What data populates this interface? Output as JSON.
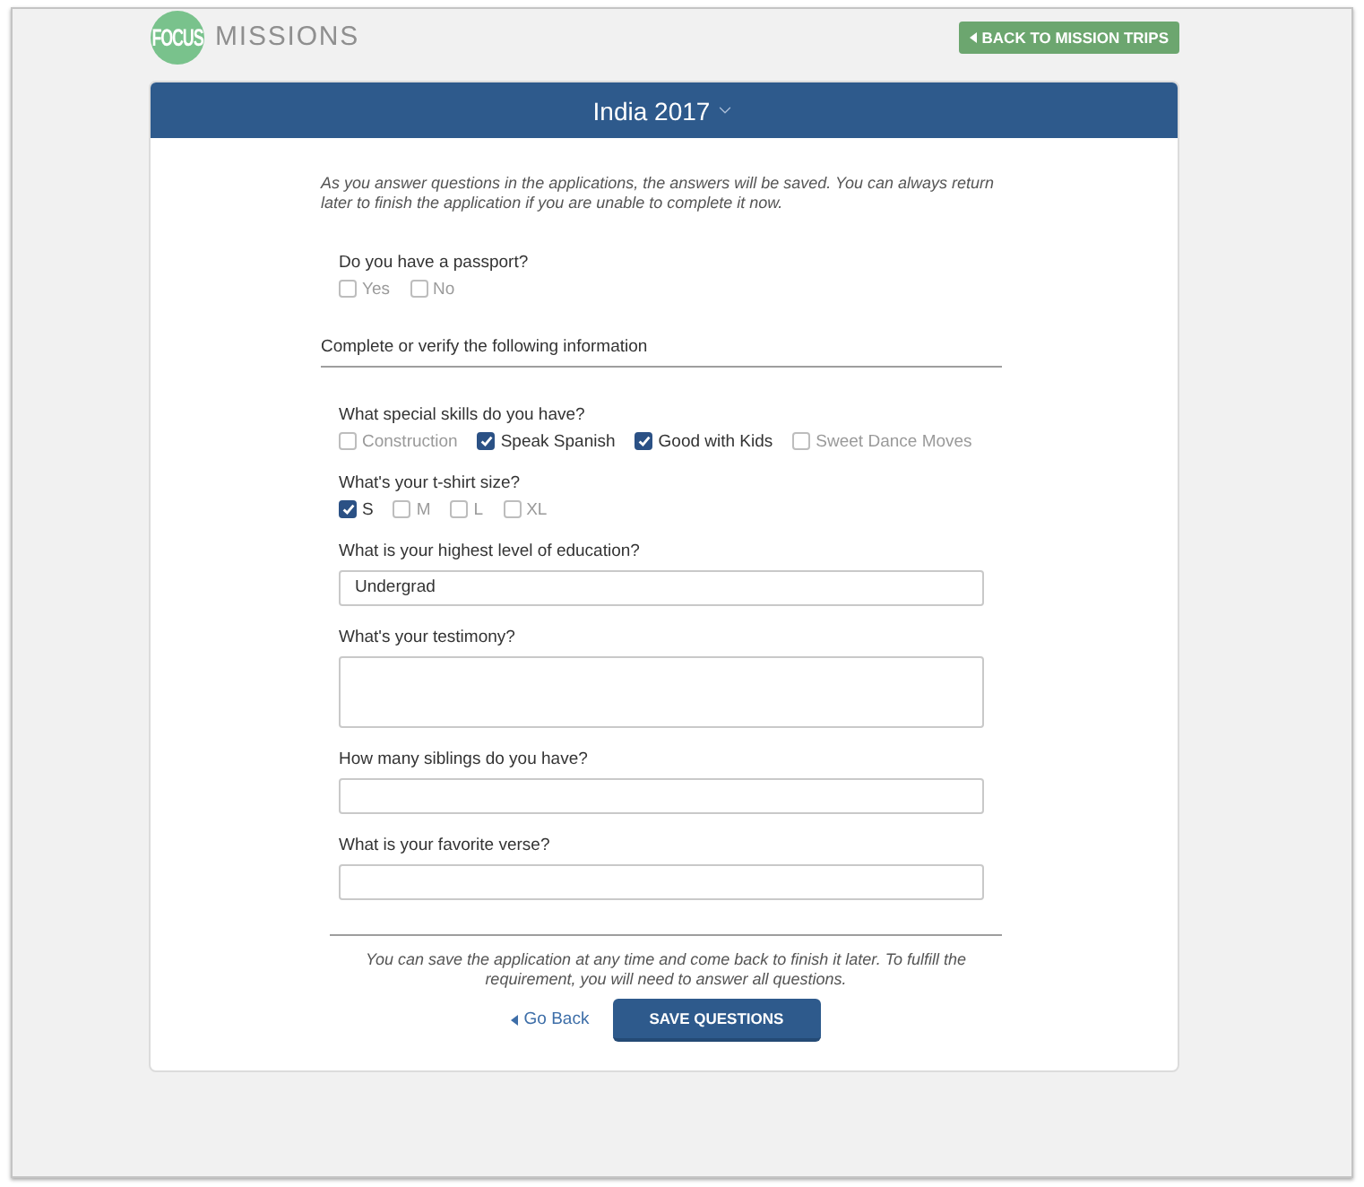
{
  "logo": {
    "mark": "FOCUS",
    "wordmark": "MISSIONS"
  },
  "back_button": {
    "label": "BACK TO MISSION TRIPS"
  },
  "trip": {
    "title": "India 2017"
  },
  "intro": "As you answer questions in the applications, the answers will be saved. You can always return later to finish the application if you are unable to complete it now.",
  "questions": [
    {
      "kind": "checkboxes",
      "label": "Do you have a passport?",
      "options": [
        {
          "label": "Yes",
          "checked": false
        },
        {
          "label": "No",
          "checked": false
        }
      ]
    }
  ],
  "section": {
    "heading": "Complete or verify the following information",
    "fields": [
      {
        "kind": "checkboxes",
        "label": "What special skills do you have?",
        "options": [
          {
            "label": "Construction",
            "checked": false
          },
          {
            "label": "Speak Spanish",
            "checked": true
          },
          {
            "label": "Good with Kids",
            "checked": true
          },
          {
            "label": "Sweet Dance Moves",
            "checked": false
          }
        ]
      },
      {
        "kind": "checkboxes",
        "label": "What's your t-shirt size?",
        "options": [
          {
            "label": "S",
            "checked": true
          },
          {
            "label": "M",
            "checked": false
          },
          {
            "label": "L",
            "checked": false
          },
          {
            "label": "XL",
            "checked": false
          }
        ]
      },
      {
        "kind": "text",
        "label": "What is your highest level of education?",
        "value": "Undergrad"
      },
      {
        "kind": "textarea",
        "label": "What's your testimony?"
      },
      {
        "kind": "text",
        "label": "How many siblings do you have?"
      },
      {
        "kind": "text",
        "label": "What is your favorite verse?"
      }
    ]
  },
  "footer_note": "You can save the application at any time and come back to finish it later. To fulfill the requirement, you will need to answer all questions.",
  "actions": {
    "go_back": "Go Back",
    "save": "SAVE QUESTIONS"
  }
}
